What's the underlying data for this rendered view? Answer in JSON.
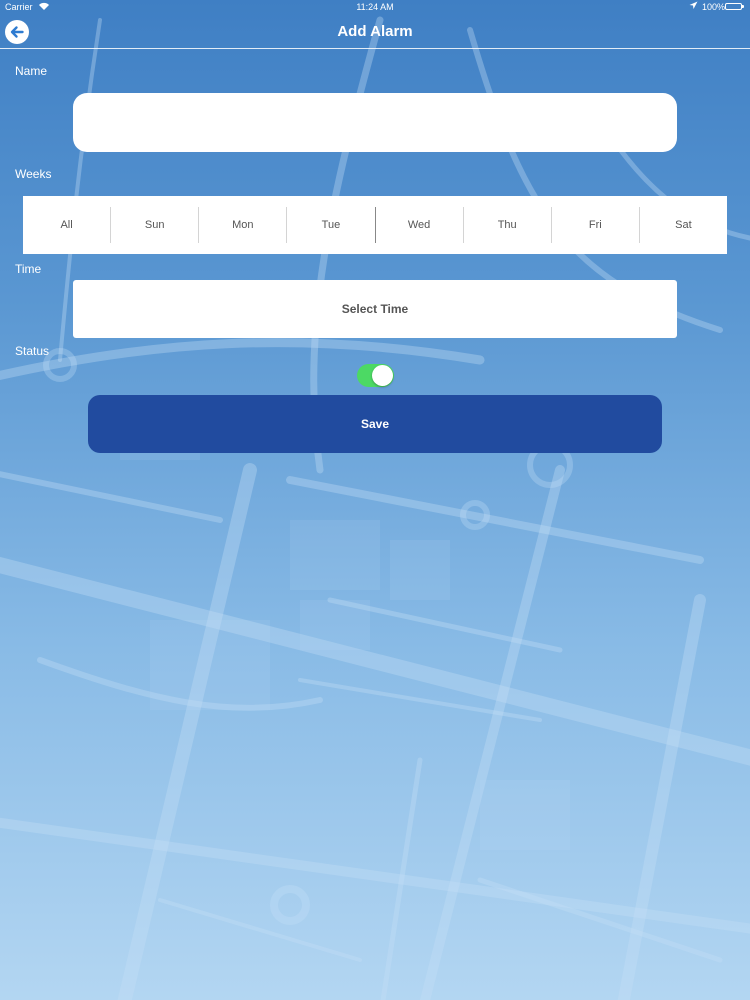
{
  "status_bar": {
    "carrier": "Carrier",
    "time": "11:24 AM",
    "battery": "100%"
  },
  "nav": {
    "title": "Add Alarm",
    "back_icon": "arrow-left-icon"
  },
  "form": {
    "name_label": "Name",
    "name_value": "",
    "name_placeholder": "",
    "weeks_label": "Weeks",
    "days": [
      "All",
      "Sun",
      "Mon",
      "Tue",
      "Wed",
      "Thu",
      "Fri",
      "Sat"
    ],
    "time_label": "Time",
    "time_button": "Select Time",
    "status_label": "Status",
    "status_on": true,
    "save_label": "Save"
  },
  "colors": {
    "save_button": "#214b9f",
    "toggle_on": "#4cd964",
    "background_top": "#3f7fc4",
    "background_bottom": "#b3d6f2"
  }
}
